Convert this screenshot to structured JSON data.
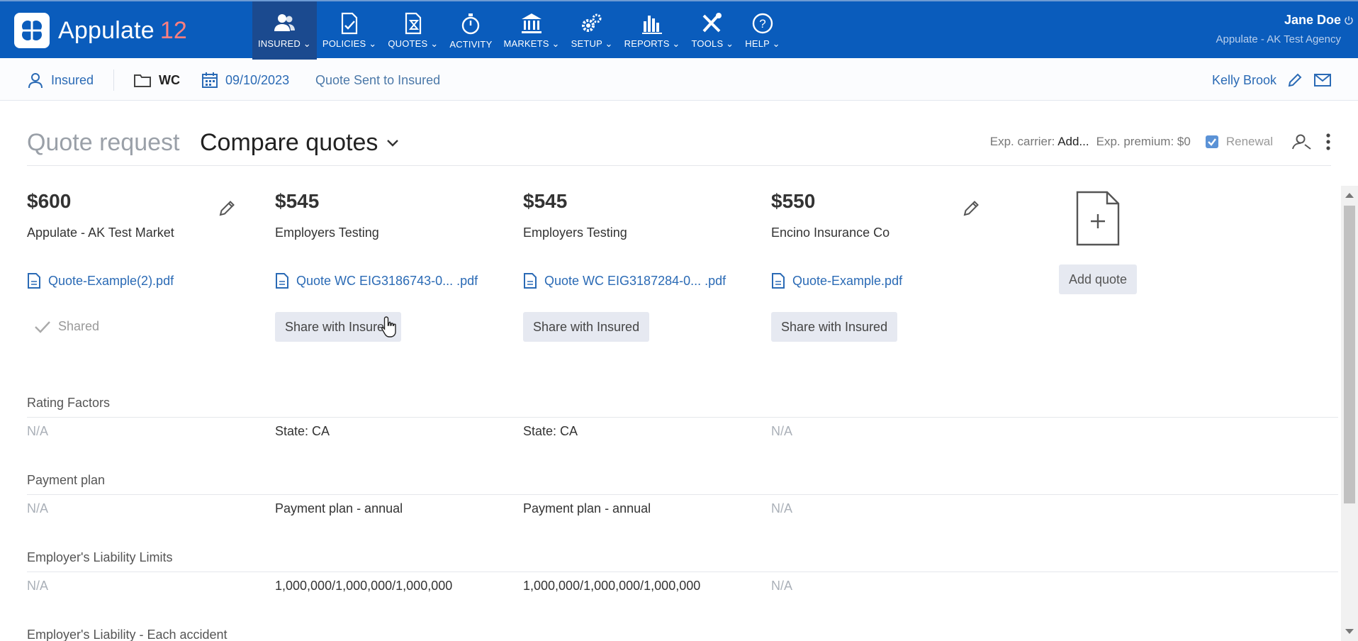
{
  "app": {
    "name": "Appulate",
    "version": "12"
  },
  "nav": [
    {
      "label": "INSURED",
      "icon": "users-icon",
      "active": true
    },
    {
      "label": "POLICIES",
      "icon": "policy-check-icon"
    },
    {
      "label": "QUOTES",
      "icon": "quote-hourglass-icon"
    },
    {
      "label": "ACTIVITY",
      "icon": "stopwatch-icon"
    },
    {
      "label": "MARKETS",
      "icon": "bank-icon"
    },
    {
      "label": "SETUP",
      "icon": "gears-icon"
    },
    {
      "label": "REPORTS",
      "icon": "bar-chart-icon"
    },
    {
      "label": "TOOLS",
      "icon": "tools-icon"
    },
    {
      "label": "HELP",
      "icon": "help-icon"
    }
  ],
  "user": {
    "name": "Jane Doe",
    "agency": "Appulate - AK Test Agency"
  },
  "subbar": {
    "insured": "Insured",
    "line": "WC",
    "date": "09/10/2023",
    "status": "Quote Sent to Insured",
    "agent": "Kelly Brook"
  },
  "title": {
    "quote_request": "Quote request",
    "compare": "Compare quotes"
  },
  "tools": {
    "exp_carrier_label": "Exp. carrier:",
    "exp_carrier_value": "Add...",
    "exp_premium": "Exp. premium: $0",
    "renewal": "Renewal"
  },
  "quotes": [
    {
      "price": "$600",
      "carrier": "Appulate - AK Test Market",
      "file": "Quote-Example(2).pdf",
      "status": "Shared"
    },
    {
      "price": "$545",
      "carrier": "Employers Testing",
      "file": "Quote WC EIG3186743-0...  .pdf",
      "button": "Share with Insured"
    },
    {
      "price": "$545",
      "carrier": "Employers Testing",
      "file": "Quote WC EIG3187284-0...  .pdf",
      "button": "Share with Insured"
    },
    {
      "price": "$550",
      "carrier": "Encino Insurance Co",
      "file": "Quote-Example.pdf",
      "button": "Share with Insured"
    }
  ],
  "add_quote": "Add quote",
  "sections": [
    {
      "label": "Rating Factors",
      "values": [
        "N/A",
        "State: CA",
        "State: CA",
        "N/A"
      ]
    },
    {
      "label": "Payment plan",
      "values": [
        "N/A",
        "Payment plan - annual",
        "Payment plan - annual",
        "N/A"
      ]
    },
    {
      "label": "Employer's Liability Limits",
      "values": [
        "N/A",
        "1,000,000/1,000,000/1,000,000",
        "1,000,000/1,000,000/1,000,000",
        "N/A"
      ]
    },
    {
      "label": "Employer's Liability - Each accident",
      "values": []
    }
  ]
}
